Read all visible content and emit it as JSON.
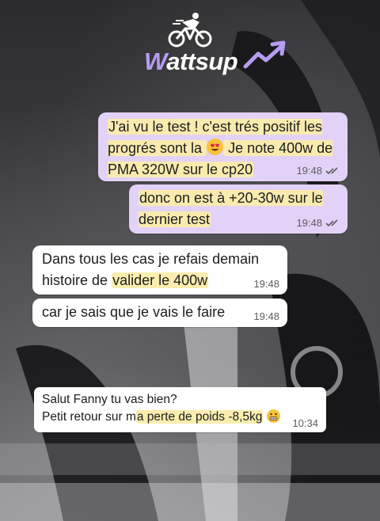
{
  "brand": {
    "name_initial": "W",
    "name_rest": "attsup",
    "bike_icon": "cyclist-icon",
    "arrow_icon": "trend-up-arrow-icon",
    "accent": "#b79cf2"
  },
  "messages": [
    {
      "direction": "outgoing",
      "segments": [
        "J'ai vu le test ! c'est trés positif les progrés sont la ",
        " Je note 400w de PMA 320W sur le cp20"
      ],
      "emoji": "heart-eyes-emoji-icon",
      "time": "19:48",
      "status": "read"
    },
    {
      "direction": "outgoing",
      "text": "donc on est à +20-30w sur le dernier test",
      "time": "19:48",
      "status": "read"
    },
    {
      "direction": "incoming",
      "text_plain": "Dans tous les cas je refais demain histoire de ",
      "text_highlight": "valider le 400w",
      "time": "19:48"
    },
    {
      "direction": "incoming",
      "text": "car je sais que je vais le faire",
      "time": "19:48"
    },
    {
      "direction": "incoming",
      "line1": "Salut Fanny tu vas bien?",
      "line2_plain": "Petit retour sur m",
      "line2_highlight": "a perte de poids -8,5kg",
      "emoji": "grimacing-face-emoji-icon",
      "time": "10:34"
    }
  ],
  "colors": {
    "outgoing_bubble": "#e3d2f7",
    "incoming_bubble": "#ffffff",
    "highlight": "#faecaa"
  }
}
